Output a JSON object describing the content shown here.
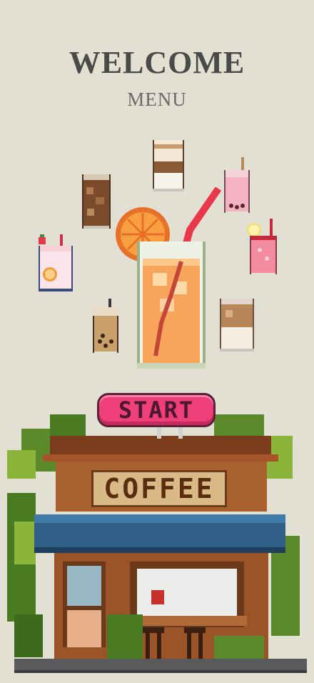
{
  "header": {
    "title": "WELCOME",
    "subtitle": "MENU"
  },
  "start_button": {
    "label": "START"
  },
  "shop": {
    "sign": "COFFEE"
  },
  "drinks": [
    "latte",
    "iced-coffee",
    "strawberry-milk",
    "pink-bubble-tea",
    "orange-juice",
    "pink-lemonade",
    "bubble-milk-tea",
    "iced-latte"
  ],
  "colors": {
    "background": "#e2e0d3",
    "start_button": "#ef3f78",
    "awning": "#2f5f86"
  }
}
